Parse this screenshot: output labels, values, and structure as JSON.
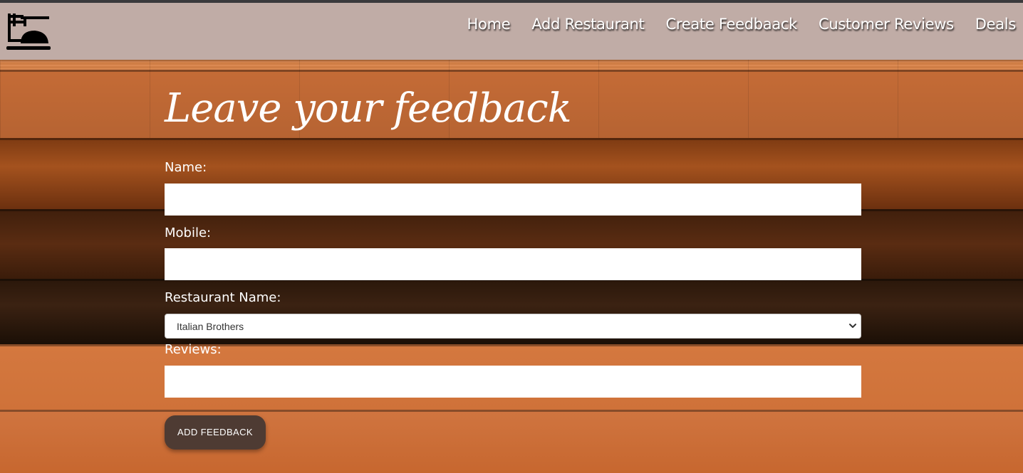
{
  "nav": {
    "logo_icon": "restaurant-logo-icon",
    "links": [
      "Home",
      "Add Restaurant",
      "Create Feedbaack",
      "Customer Reviews",
      "Deals"
    ]
  },
  "form": {
    "title": "Leave your feedback",
    "name_label": "Name:",
    "name_value": "",
    "mobile_label": "Mobile:",
    "mobile_value": "",
    "restaurant_label": "Restaurant Name:",
    "restaurant_selected": "Italian Brothers",
    "reviews_label": "Reviews:",
    "reviews_value": "",
    "submit_label": "ADD FEEDBACK"
  },
  "colors": {
    "navbar_bg": "#c0aca6",
    "button_bg": "#4e3b33",
    "wood_light": "#cf7139",
    "wood_dark": "#2a170a"
  }
}
